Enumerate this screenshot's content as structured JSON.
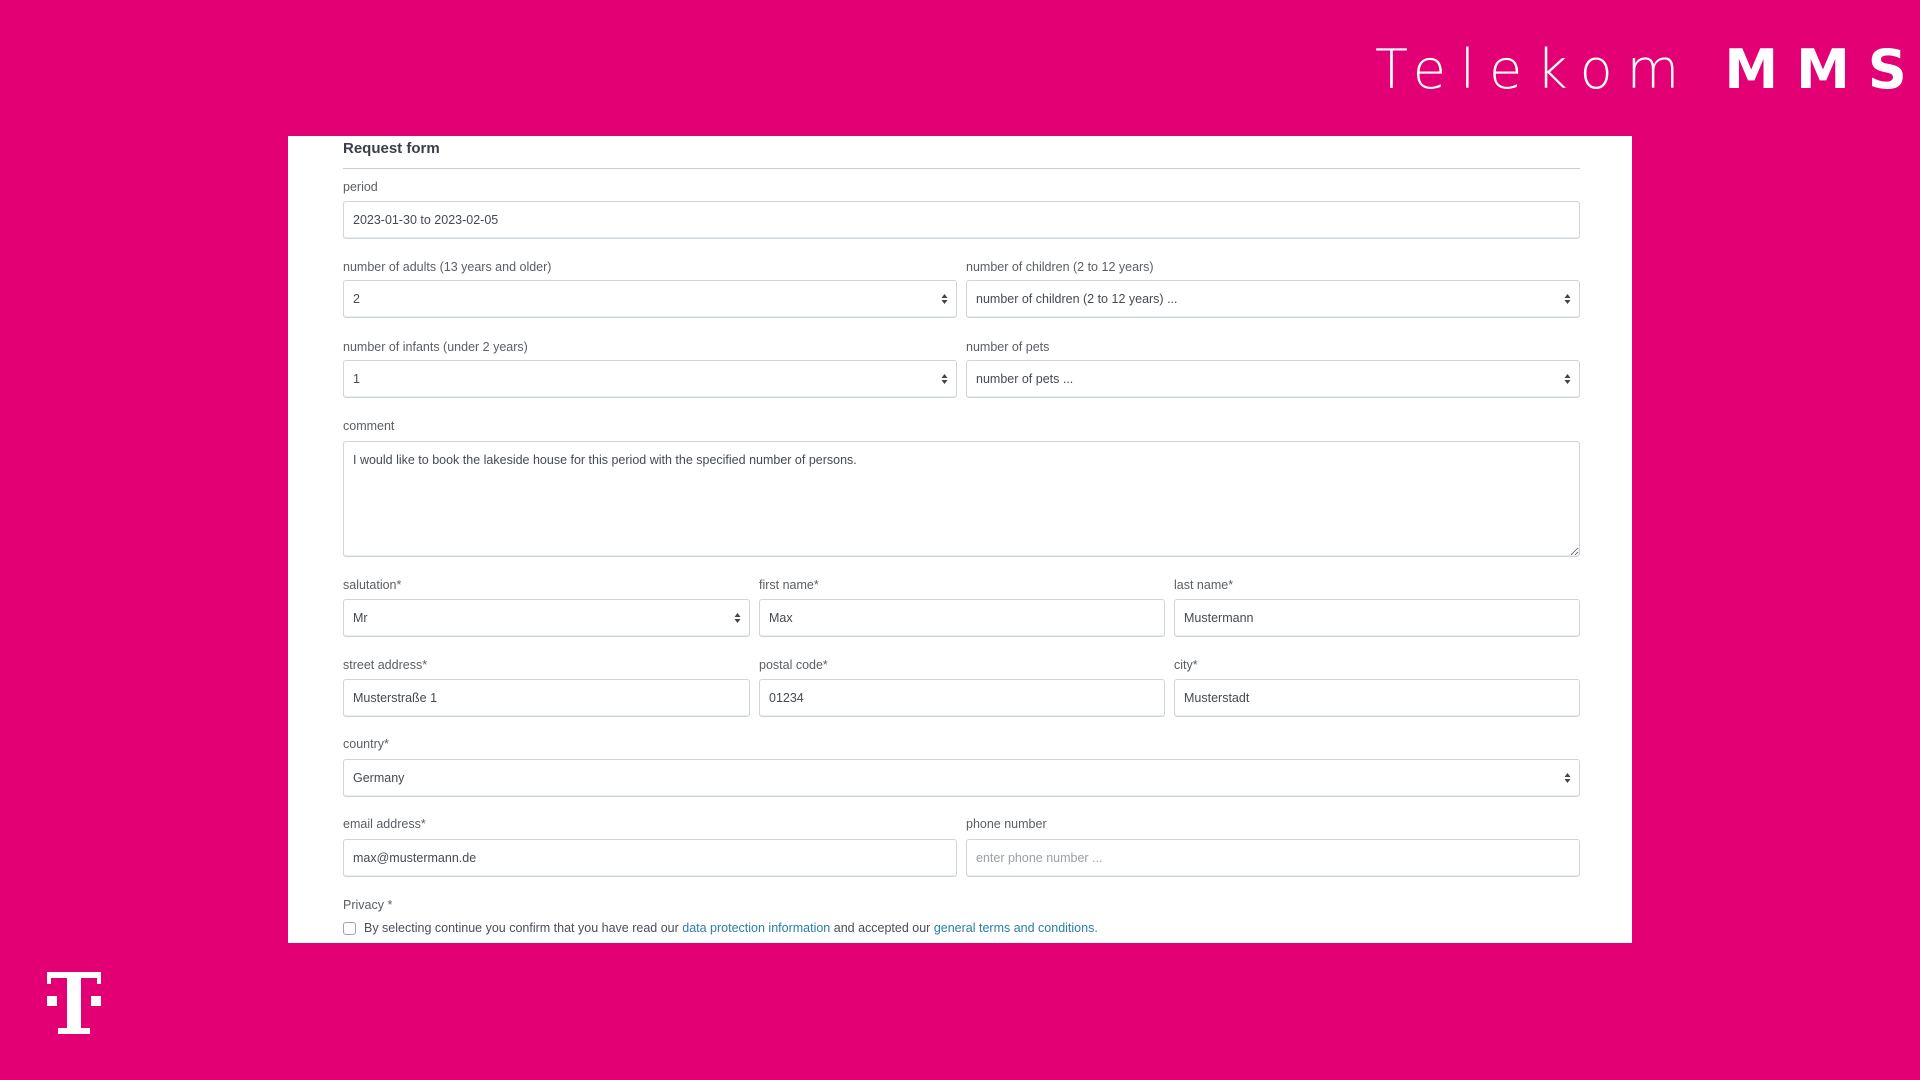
{
  "branding": {
    "company": "Telekom",
    "product": "MMS",
    "background_color": "#e20074",
    "link_color": "#2a7fa8"
  },
  "form": {
    "title": "Request form",
    "period": {
      "label": "period",
      "value": "2023-01-30 to 2023-02-05"
    },
    "adults": {
      "label": "number of adults (13 years and older)",
      "value": "2"
    },
    "children": {
      "label": "number of children (2 to 12 years)",
      "placeholder": "number of children (2 to 12 years) ..."
    },
    "infants": {
      "label": "number of infants (under 2 years)",
      "value": "1"
    },
    "pets": {
      "label": "number of pets",
      "placeholder": "number of pets ..."
    },
    "comment": {
      "label": "comment",
      "value": "I would like to book the lakeside house for this period with the specified number of persons."
    },
    "salutation": {
      "label": "salutation*",
      "value": "Mr"
    },
    "first_name": {
      "label": "first name*",
      "value": "Max"
    },
    "last_name": {
      "label": "last name*",
      "value": "Mustermann"
    },
    "street": {
      "label": "street address*",
      "value": "Musterstraße 1"
    },
    "postal_code": {
      "label": "postal code*",
      "value": "01234"
    },
    "city": {
      "label": "city*",
      "value": "Musterstadt"
    },
    "country": {
      "label": "country*",
      "value": "Germany"
    },
    "email": {
      "label": "email address*",
      "value": "max@mustermann.de"
    },
    "phone": {
      "label": "phone number",
      "placeholder": "enter phone number ..."
    },
    "privacy": {
      "label": "Privacy *",
      "checked": false,
      "text_before": "By selecting continue you confirm that you have read our ",
      "link1": "data protection information",
      "text_middle": " and accepted our ",
      "link2": "general terms and conditions",
      "text_after": "."
    }
  }
}
